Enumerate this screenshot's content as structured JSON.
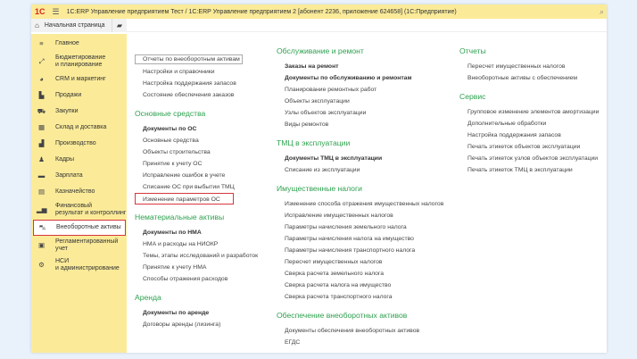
{
  "title_bar": {
    "logo": "1С",
    "title": "1С:ERP Управление предприятием Тест / 1С:ERP Управление предприятием 2 [абонент 2236, приложение 624658]  (1С:Предприятие)"
  },
  "tabs": {
    "home": "Начальная страница"
  },
  "sidebar": {
    "items": [
      {
        "label": "Главное",
        "icon": "menu-icon"
      },
      {
        "label": "Бюджетирование\nи планирование",
        "icon": "chart-icon"
      },
      {
        "label": "CRM и маркетинг",
        "icon": "pie-icon"
      },
      {
        "label": "Продажи",
        "icon": "bag-icon"
      },
      {
        "label": "Закупки",
        "icon": "cart-icon"
      },
      {
        "label": "Склад и доставка",
        "icon": "grid-icon"
      },
      {
        "label": "Производство",
        "icon": "factory-icon"
      },
      {
        "label": "Кадры",
        "icon": "person-icon"
      },
      {
        "label": "Зарплата",
        "icon": "card-icon"
      },
      {
        "label": "Казначейство",
        "icon": "treasury-icon"
      },
      {
        "label": "Финансовый\nрезультат и контроллинг",
        "icon": "bar-chart-icon"
      },
      {
        "label": "Внеоборотные активы",
        "icon": "car-icon",
        "selected": true
      },
      {
        "label": "Регламентированный\nучет",
        "icon": "lock-icon"
      },
      {
        "label": "НСИ\nи администрирование",
        "icon": "gear-icon"
      }
    ]
  },
  "columns": [
    [
      {
        "items": [
          {
            "label": "Отчеты по внеоборотным активам",
            "style": "boxg"
          },
          {
            "label": "Настройки и справочники"
          },
          {
            "label": "Настройка поддержания запасов"
          },
          {
            "label": "Состояние обеспечения заказов"
          }
        ]
      },
      {
        "heading": "Основные средства",
        "items": [
          {
            "label": "Документы по ОС",
            "style": "b"
          },
          {
            "label": "Основные средства"
          },
          {
            "label": "Объекты строительства"
          },
          {
            "label": "Принятие к учету ОС"
          },
          {
            "label": "Исправление ошибок в учете"
          },
          {
            "label": "Списание ОС при выбытии ТМЦ"
          },
          {
            "label": "Изменение параметров ОС",
            "style": "boxr"
          }
        ]
      },
      {
        "heading": "Нематериальные активы",
        "items": [
          {
            "label": "Документы по НМА",
            "style": "b"
          },
          {
            "label": "НМА и расходы на НИОКР"
          },
          {
            "label": "Темы, этапы исследований и разработок"
          },
          {
            "label": "Принятие к учету НМА"
          },
          {
            "label": "Способы отражения расходов"
          }
        ]
      },
      {
        "heading": "Аренда",
        "items": [
          {
            "label": "Документы по аренде",
            "style": "b"
          },
          {
            "label": "Договоры аренды (лизинга)"
          }
        ]
      }
    ],
    [
      {
        "heading": "Обслуживание и ремонт",
        "items": [
          {
            "label": "Заказы на ремонт",
            "style": "b"
          },
          {
            "label": "Документы по обслуживанию и ремонтам",
            "style": "b"
          },
          {
            "label": "Планирование ремонтных работ"
          },
          {
            "label": "Объекты эксплуатации"
          },
          {
            "label": "Узлы объектов эксплуатации"
          },
          {
            "label": "Виды ремонтов"
          }
        ]
      },
      {
        "heading": "ТМЦ в эксплуатации",
        "items": [
          {
            "label": "Документы ТМЦ в эксплуатации",
            "style": "b"
          },
          {
            "label": "Списание из эксплуатации"
          }
        ]
      },
      {
        "heading": "Имущественные налоги",
        "items": [
          {
            "label": "Изменение способа отражения имущественных налогов"
          },
          {
            "label": "Исправление имущественных налогов"
          },
          {
            "label": "Параметры начисления земельного налога"
          },
          {
            "label": "Параметры начисления налога на имущество"
          },
          {
            "label": "Параметры начисления транспортного налога"
          },
          {
            "label": "Пересчет имущественных налогов"
          },
          {
            "label": "Сверка расчета земельного налога"
          },
          {
            "label": "Сверка расчета налога на имущество"
          },
          {
            "label": "Сверка расчета транспортного налога"
          }
        ]
      },
      {
        "heading": "Обеспечение внеоборотных активов",
        "items": [
          {
            "label": "Документы обеспечения внеоборотных активов"
          },
          {
            "label": "ЕГДС"
          }
        ]
      }
    ],
    [
      {
        "heading": "Отчеты",
        "items": [
          {
            "label": "Пересчет имущественных налогов"
          },
          {
            "label": "Внеоборотные активы с обеспечением"
          }
        ]
      },
      {
        "heading": "Сервис",
        "items": [
          {
            "label": "Групповое изменение элементов амортизации"
          },
          {
            "label": "Дополнительные обработки"
          },
          {
            "label": "Настройка поддержания запасов"
          },
          {
            "label": "Печать этикеток объектов эксплуатации"
          },
          {
            "label": "Печать этикеток узлов объектов эксплуатации"
          },
          {
            "label": "Печать этикеток ТМЦ в эксплуатации"
          }
        ]
      }
    ]
  ]
}
